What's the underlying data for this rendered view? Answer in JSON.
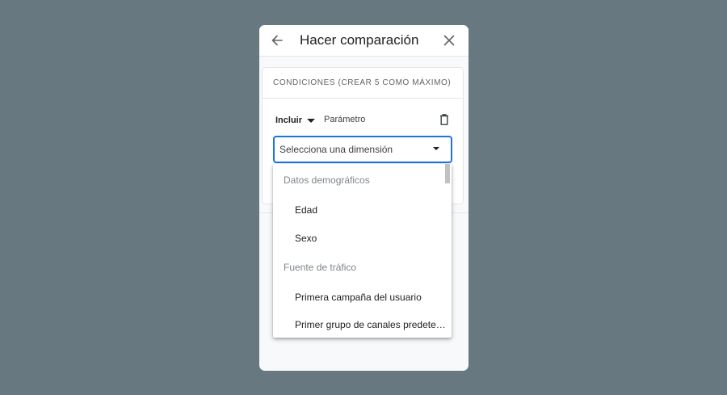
{
  "header": {
    "title": "Hacer comparación"
  },
  "conditions": {
    "title": "CONDICIONES (CREAR 5 COMO MÁXIMO)",
    "include_label": "Incluir",
    "param_label": "Parámetro",
    "select_placeholder": "Selecciona una dimensión"
  },
  "dropdown": {
    "groups": [
      {
        "label": "Datos demográficos",
        "options": [
          "Edad",
          "Sexo"
        ]
      },
      {
        "label": "Fuente de tráfico",
        "options": [
          "Primera campaña del usuario",
          "Primer grupo de canales predete…"
        ]
      }
    ]
  },
  "colors": {
    "accent": "#1a73e8",
    "background": "#677880"
  },
  "icons": [
    "arrow-back-icon",
    "close-icon",
    "trash-icon",
    "chevron-down-icon"
  ]
}
